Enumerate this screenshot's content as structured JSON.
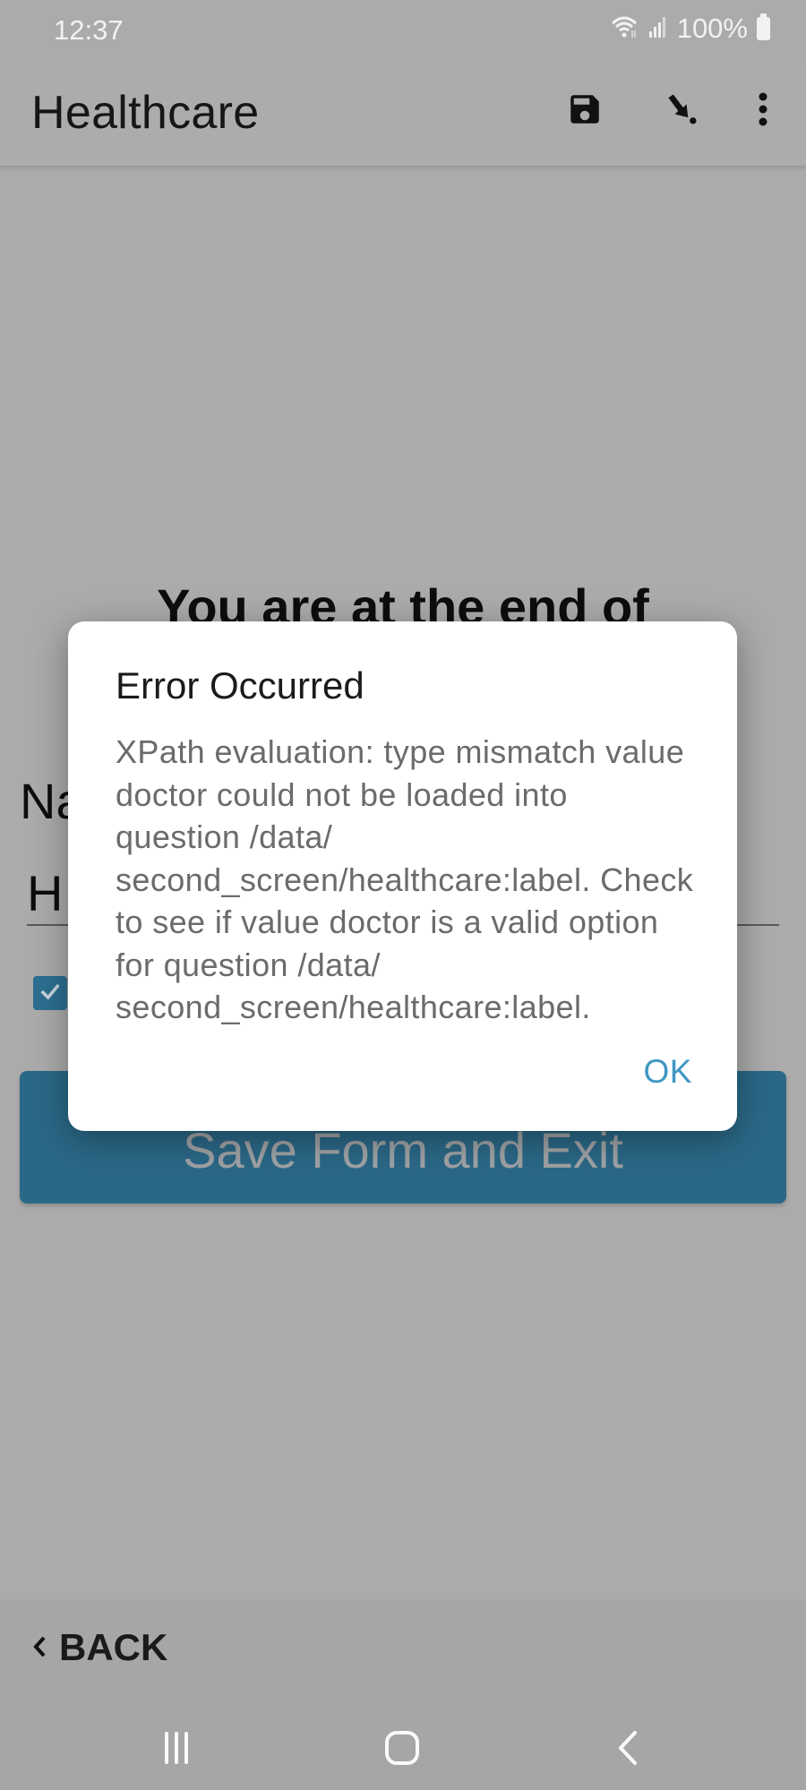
{
  "status_bar": {
    "time": "12:37",
    "wifi_icon": "wifi-icon",
    "signal_icon": "signal-icon",
    "battery_percent": "100%",
    "battery_icon": "battery-full-icon"
  },
  "app_bar": {
    "title": "Healthcare",
    "actions": [
      {
        "name": "save",
        "icon": "save-icon"
      },
      {
        "name": "go-to",
        "icon": "jump-arrow-icon"
      },
      {
        "name": "more",
        "icon": "more-vertical-icon"
      }
    ]
  },
  "form": {
    "end_heading": "You are at the end of",
    "name_label": "Na",
    "name_value": "H",
    "checkbox_checked": true,
    "save_exit_label": "Save Form and Exit"
  },
  "dialog": {
    "title": "Error Occurred",
    "message": "XPath evaluation: type mismatch value doctor could not be loaded into question /data/ second_screen/healthcare:label. Check to see if value doctor is a valid option for question /data/ second_screen/healthcare:label.",
    "ok_label": "OK"
  },
  "bottom_bar": {
    "back_label": "BACK"
  },
  "nav_bar": {
    "recents_icon": "recents-icon",
    "home_icon": "home-icon",
    "back_icon": "back-icon"
  },
  "colors": {
    "accent": "#3f97c3",
    "button": "#2b6887",
    "scrim_bg": "#ababab"
  }
}
